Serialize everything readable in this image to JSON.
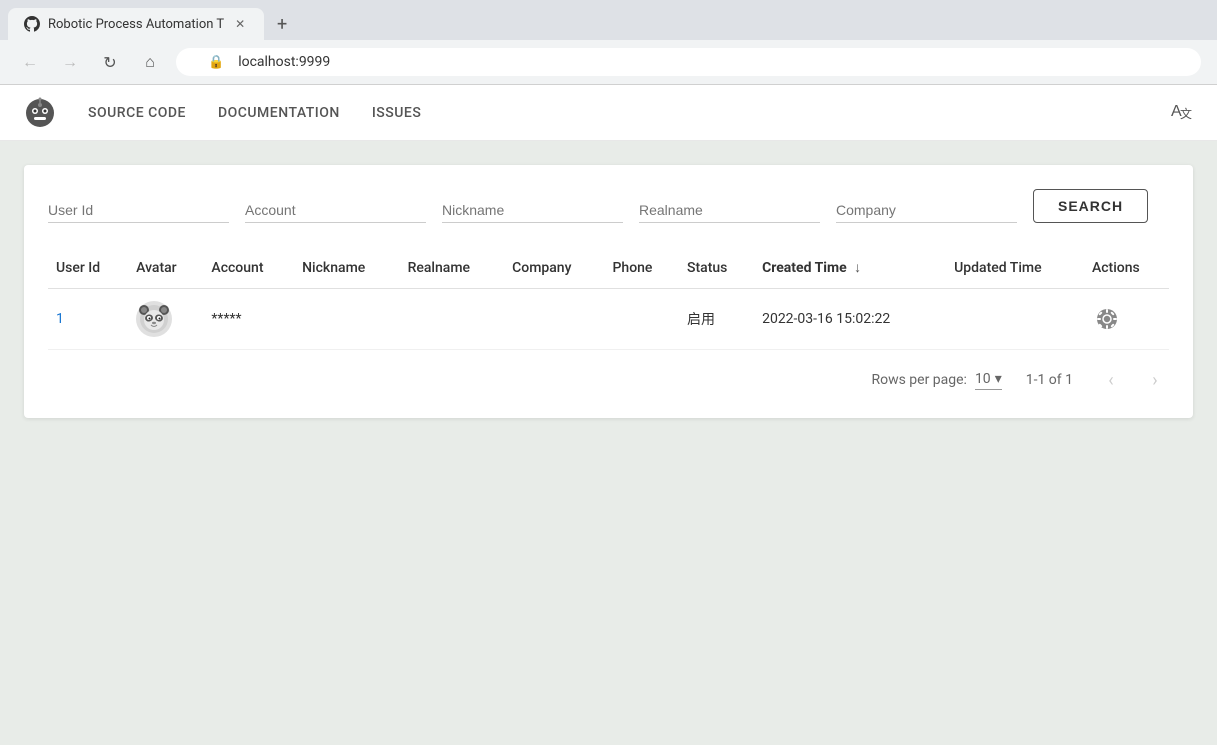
{
  "browser": {
    "tab_title": "Robotic Process Automation T",
    "tab_url": "localhost:9999",
    "new_tab_tooltip": "New tab"
  },
  "nav": {
    "source_code": "SOURCE CODE",
    "documentation": "DOCUMENTATION",
    "issues": "ISSUES"
  },
  "filters": {
    "user_id_placeholder": "User Id",
    "account_placeholder": "Account",
    "nickname_placeholder": "Nickname",
    "realname_placeholder": "Realname",
    "company_placeholder": "Company",
    "search_label": "SEARCH"
  },
  "table": {
    "columns": {
      "user_id": "User Id",
      "avatar": "Avatar",
      "account": "Account",
      "nickname": "Nickname",
      "realname": "Realname",
      "company": "Company",
      "phone": "Phone",
      "status": "Status",
      "created_time": "Created Time",
      "updated_time": "Updated Time",
      "actions": "Actions"
    },
    "rows": [
      {
        "user_id": "1",
        "account": "*****",
        "nickname": "",
        "realname": "",
        "company": "",
        "phone": "",
        "status": "启用",
        "created_time": "2022-03-16 15:02:22",
        "updated_time": ""
      }
    ]
  },
  "pagination": {
    "rows_per_page_label": "Rows per page:",
    "rows_per_page_value": "10",
    "page_info": "1-1 of 1"
  },
  "icons": {
    "back": "←",
    "forward": "→",
    "reload": "↺",
    "home": "⌂",
    "lock": "🔒",
    "sort_desc": "↓",
    "chevron_down": "▾",
    "chevron_left": "‹",
    "chevron_right": "›",
    "translate": "A",
    "settings": "⚙"
  }
}
